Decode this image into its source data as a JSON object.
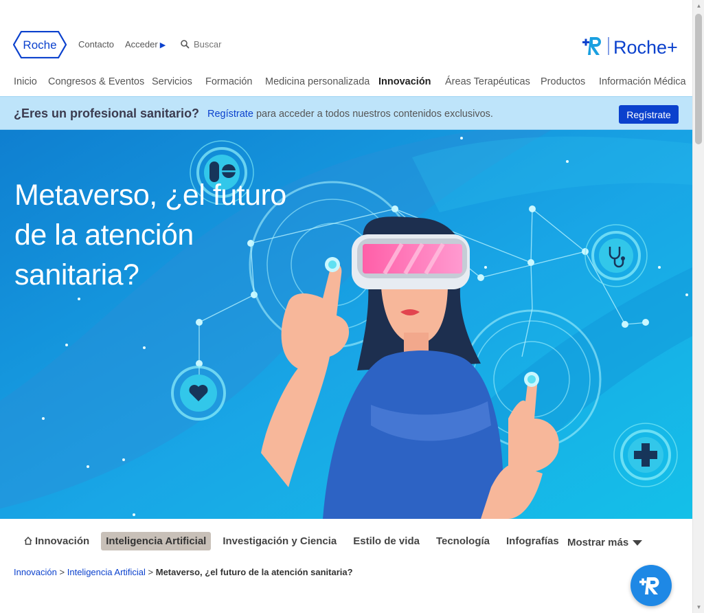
{
  "header": {
    "logo_text": "Roche",
    "contacto": "Contacto",
    "acceder": "Acceder",
    "search_placeholder": "Buscar",
    "rocheplus_logo_text": "Roche+"
  },
  "nav": {
    "items": [
      "Inicio",
      "Congresos & Eventos",
      "Servicios",
      "Formación",
      "Medicina personalizada",
      "Innovación",
      "Áreas Terapéuticas",
      "Productos",
      "Información Médica"
    ],
    "active": "Innovación"
  },
  "banner": {
    "question": "¿Eres un profesional sanitario?",
    "link": "Regístrate",
    "text": "para acceder a todos nuestros contenidos exclusivos.",
    "button": "Regístrate"
  },
  "hero": {
    "title_line1": "Metaverso, ¿el futuro",
    "title_line2": "de la atención",
    "title_line3": "sanitaria?"
  },
  "tabs": {
    "home": "Innovación",
    "items": [
      "Inteligencia Artificial",
      "Investigación y Ciencia",
      "Estilo de vida",
      "Tecnología",
      "Infografías"
    ],
    "selected": "Inteligencia Artificial",
    "more": "Mostrar más"
  },
  "breadcrumb": {
    "level1": "Innovación",
    "sep": ">",
    "level2": "Inteligencia Artificial",
    "current": "Metaverso, ¿el futuro de la atención sanitaria?"
  },
  "colors": {
    "roche_blue": "#0b41cd",
    "banner_bg": "#bee4fa",
    "hero_bg": "#1aa0e0",
    "fab": "#1e88e5",
    "selected_tab": "#c8c0b8"
  },
  "icons": [
    "roche-logo",
    "caret-right-icon",
    "search-icon",
    "rocheplus-logo",
    "home-icon",
    "chevron-down-icon",
    "rocheplus-chat-icon"
  ]
}
